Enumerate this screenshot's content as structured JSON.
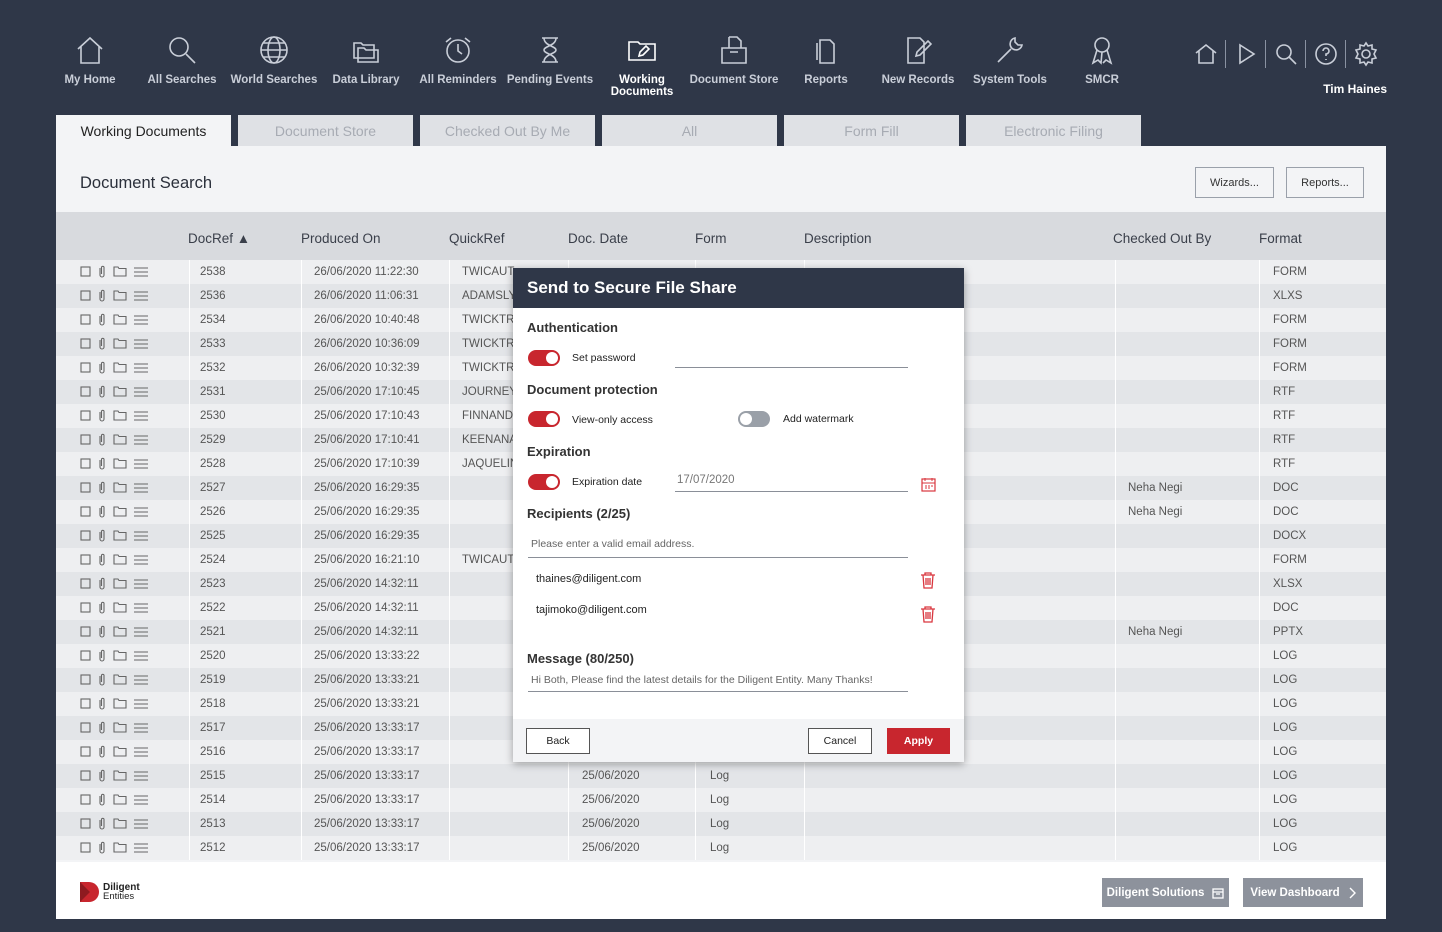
{
  "nav": [
    {
      "label": "My Home",
      "icon": "home-icon"
    },
    {
      "label": "All Searches",
      "icon": "search-icon"
    },
    {
      "label": "World Searches",
      "icon": "globe-icon"
    },
    {
      "label": "Data Library",
      "icon": "folders-icon"
    },
    {
      "label": "All Reminders",
      "icon": "alarm-clock-icon"
    },
    {
      "label": "Pending Events",
      "icon": "hourglass-icon"
    },
    {
      "label": "Working Documents",
      "icon": "folder-edit-icon",
      "active": true
    },
    {
      "label": "Document Store",
      "icon": "document-box-icon"
    },
    {
      "label": "Reports",
      "icon": "report-icon"
    },
    {
      "label": "New Records",
      "icon": "new-record-icon"
    },
    {
      "label": "System Tools",
      "icon": "wrench-icon"
    },
    {
      "label": "SMCR",
      "icon": "award-icon"
    }
  ],
  "user": {
    "name": "Tim Haines"
  },
  "tabs": [
    "Working Documents",
    "Document Store",
    "Checked Out By Me",
    "All",
    "Form Fill",
    "Electronic Filing"
  ],
  "panel": {
    "title": "Document Search",
    "wizards_label": "Wizards...",
    "reports_label": "Reports..."
  },
  "columns": {
    "docref": "DocRef ▲",
    "produced": "Produced On",
    "quickref": "QuickRef",
    "docdate": "Doc. Date",
    "form": "Form",
    "description": "Description",
    "checkedout": "Checked Out By",
    "format": "Format"
  },
  "rows": [
    {
      "ref": "2538",
      "produced": "26/06/2020 11:22:30",
      "quick": "TWICAUT",
      "docdate": "",
      "form": "",
      "checked": "",
      "format": "FORM"
    },
    {
      "ref": "2536",
      "produced": "26/06/2020 11:06:31",
      "quick": "ADAMSLY",
      "docdate": "",
      "form": "",
      "checked": "",
      "format": "XLXS"
    },
    {
      "ref": "2534",
      "produced": "26/06/2020 10:40:48",
      "quick": "TWICKTR/",
      "docdate": "",
      "form": "",
      "checked": "",
      "format": "FORM"
    },
    {
      "ref": "2533",
      "produced": "26/06/2020 10:36:09",
      "quick": "TWICKTR/",
      "docdate": "",
      "form": "",
      "checked": "",
      "format": "FORM"
    },
    {
      "ref": "2532",
      "produced": "26/06/2020 10:32:39",
      "quick": "TWICKTR/",
      "docdate": "",
      "form": "",
      "checked": "",
      "format": "FORM"
    },
    {
      "ref": "2531",
      "produced": "25/06/2020 17:10:45",
      "quick": "JOURNEY",
      "docdate": "",
      "form": "",
      "checked": "",
      "format": "RTF"
    },
    {
      "ref": "2530",
      "produced": "25/06/2020 17:10:43",
      "quick": "FINNANDI",
      "docdate": "",
      "form": "",
      "checked": "",
      "format": "RTF"
    },
    {
      "ref": "2529",
      "produced": "25/06/2020 17:10:41",
      "quick": "KEENANA",
      "docdate": "",
      "form": "",
      "checked": "",
      "format": "RTF"
    },
    {
      "ref": "2528",
      "produced": "25/06/2020 17:10:39",
      "quick": "JAQUELIN",
      "docdate": "",
      "form": "",
      "checked": "",
      "format": "RTF"
    },
    {
      "ref": "2527",
      "produced": "25/06/2020 16:29:35",
      "quick": "",
      "docdate": "",
      "form": "",
      "checked": "Neha Negi",
      "format": "DOC"
    },
    {
      "ref": "2526",
      "produced": "25/06/2020 16:29:35",
      "quick": "",
      "docdate": "",
      "form": "",
      "checked": "Neha Negi",
      "format": "DOC"
    },
    {
      "ref": "2525",
      "produced": "25/06/2020 16:29:35",
      "quick": "",
      "docdate": "",
      "form": "",
      "checked": "",
      "format": "DOCX"
    },
    {
      "ref": "2524",
      "produced": "25/06/2020 16:21:10",
      "quick": "TWICAUT",
      "docdate": "",
      "form": "",
      "checked": "",
      "format": "FORM"
    },
    {
      "ref": "2523",
      "produced": "25/06/2020 14:32:11",
      "quick": "",
      "docdate": "",
      "form": "",
      "checked": "",
      "format": "XLSX"
    },
    {
      "ref": "2522",
      "produced": "25/06/2020 14:32:11",
      "quick": "",
      "docdate": "",
      "form": "",
      "checked": "",
      "format": "DOC"
    },
    {
      "ref": "2521",
      "produced": "25/06/2020 14:32:11",
      "quick": "",
      "docdate": "",
      "form": "",
      "checked": "Neha Negi",
      "format": "PPTX"
    },
    {
      "ref": "2520",
      "produced": "25/06/2020 13:33:22",
      "quick": "",
      "docdate": "",
      "form": "",
      "checked": "",
      "format": "LOG"
    },
    {
      "ref": "2519",
      "produced": "25/06/2020 13:33:21",
      "quick": "",
      "docdate": "",
      "form": "",
      "checked": "",
      "format": "LOG"
    },
    {
      "ref": "2518",
      "produced": "25/06/2020 13:33:21",
      "quick": "",
      "docdate": "",
      "form": "",
      "checked": "",
      "format": "LOG"
    },
    {
      "ref": "2517",
      "produced": "25/06/2020 13:33:17",
      "quick": "",
      "docdate": "",
      "form": "",
      "checked": "",
      "format": "LOG"
    },
    {
      "ref": "2516",
      "produced": "25/06/2020 13:33:17",
      "quick": "",
      "docdate": "",
      "form": "",
      "checked": "",
      "format": "LOG"
    },
    {
      "ref": "2515",
      "produced": "25/06/2020 13:33:17",
      "quick": "",
      "docdate": "25/06/2020",
      "form": "Log",
      "checked": "",
      "format": "LOG"
    },
    {
      "ref": "2514",
      "produced": "25/06/2020 13:33:17",
      "quick": "",
      "docdate": "25/06/2020",
      "form": "Log",
      "checked": "",
      "format": "LOG"
    },
    {
      "ref": "2513",
      "produced": "25/06/2020 13:33:17",
      "quick": "",
      "docdate": "25/06/2020",
      "form": "Log",
      "checked": "",
      "format": "LOG"
    },
    {
      "ref": "2512",
      "produced": "25/06/2020 13:33:17",
      "quick": "",
      "docdate": "25/06/2020",
      "form": "Log",
      "checked": "",
      "format": "LOG"
    }
  ],
  "footer": {
    "logo_line1": "Diligent",
    "logo_line2": "Entities",
    "solutions_label": "Diligent Solutions",
    "dashboard_label": "View Dashboard"
  },
  "modal": {
    "title": "Send to Secure File Share",
    "auth_heading": "Authentication",
    "set_password_label": "Set password",
    "set_password_on": true,
    "password_value": "",
    "protection_heading": "Document protection",
    "view_only_label": "View-only access",
    "view_only_on": true,
    "watermark_label": "Add watermark",
    "watermark_on": false,
    "expiration_heading": "Expiration",
    "expiration_label": "Expiration date",
    "expiration_on": true,
    "expiration_value": "17/07/2020",
    "recipients_heading": "Recipients (2/25)",
    "email_placeholder": "Please enter a valid email address.",
    "recipients": [
      "thaines@diligent.com",
      "tajimoko@diligent.com"
    ],
    "message_heading": "Message (80/250)",
    "message_value": "Hi Both, Please find the latest details for the Diligent Entity. Many Thanks!",
    "back_label": "Back",
    "cancel_label": "Cancel",
    "apply_label": "Apply"
  },
  "colors": {
    "accent": "#c8262e",
    "header_bg": "#2f3748"
  }
}
